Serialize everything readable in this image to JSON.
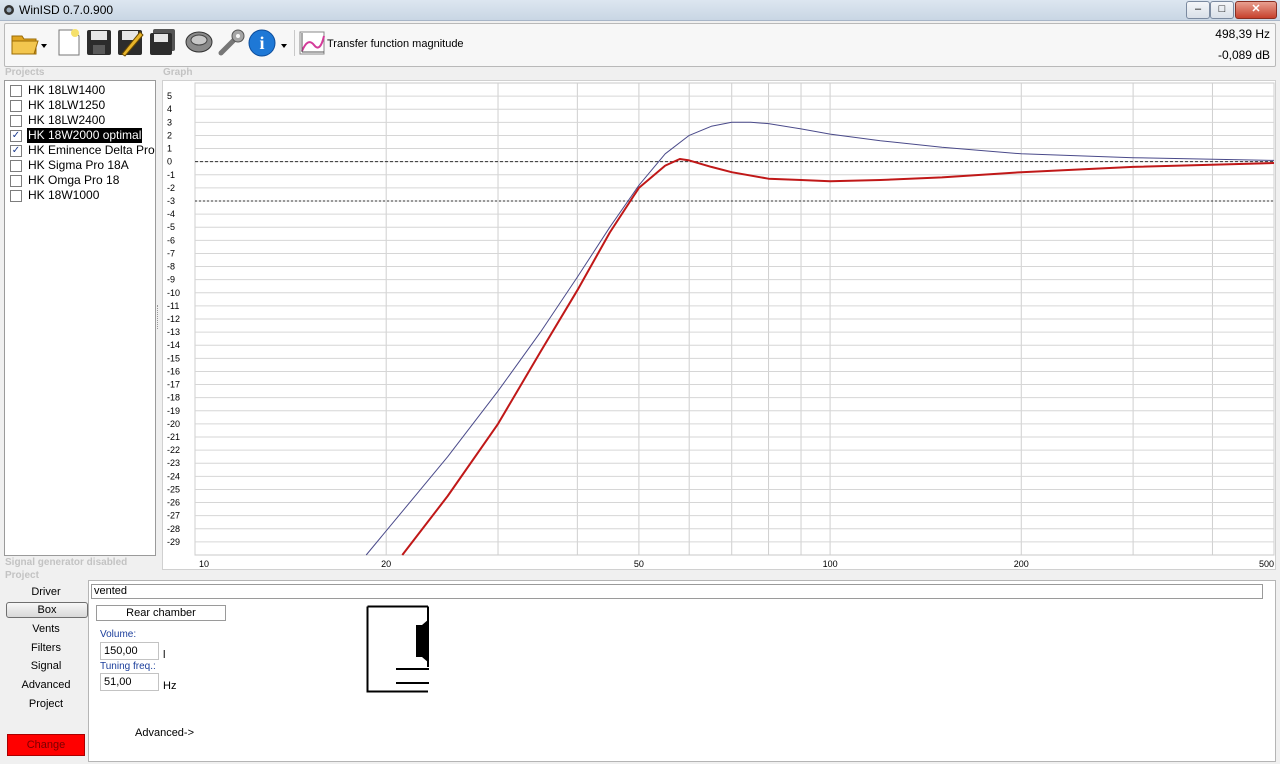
{
  "window": {
    "title": "WinISD 0.7.0.900",
    "min": "–",
    "max": "□",
    "close": "✕"
  },
  "toolbar": {
    "icons": [
      "open-folder-icon",
      "new-document-icon",
      "save-icon",
      "edit-icon",
      "save-all-icon",
      "driver-icon",
      "tools-icon",
      "info-icon",
      "graph-icon"
    ],
    "graph_label": "Transfer function magnitude",
    "readout_freq": "498,39 Hz",
    "readout_db": "-0,089 dB"
  },
  "projects": {
    "heading": "Projects",
    "items": [
      {
        "label": "HK 18LW1400",
        "checked": false,
        "selected": false
      },
      {
        "label": "HK 18LW1250",
        "checked": false,
        "selected": false
      },
      {
        "label": "HK 18LW2400",
        "checked": false,
        "selected": false
      },
      {
        "label": "HK 18W2000 optimal",
        "checked": true,
        "selected": true
      },
      {
        "label": "HK Eminence Delta Pro",
        "checked": true,
        "selected": false
      },
      {
        "label": "HK Sigma Pro 18A",
        "checked": false,
        "selected": false
      },
      {
        "label": "HK Omga Pro 18",
        "checked": false,
        "selected": false
      },
      {
        "label": "HK 18W1000",
        "checked": false,
        "selected": false
      }
    ]
  },
  "graph": {
    "heading": "Graph"
  },
  "signal_generator": "Signal generator disabled",
  "project_heading": "Project",
  "tabs": [
    "Driver",
    "Box",
    "Vents",
    "Filters",
    "Signal",
    "Advanced",
    "Project"
  ],
  "change_label": "Change",
  "box": {
    "type": "vented",
    "rear_chamber": "Rear chamber",
    "volume_label": "Volume:",
    "volume_value": "150,00",
    "volume_unit": "l",
    "tuning_label": "Tuning freq.:",
    "tuning_value": "51,00",
    "tuning_unit": "Hz",
    "advanced_link": "Advanced->"
  },
  "chart_data": {
    "type": "line",
    "x_scale": "log",
    "xlim": [
      10,
      500
    ],
    "ylim": [
      -30,
      6
    ],
    "x_ticks": [
      "10",
      "20",
      "50",
      "100",
      "200",
      "500"
    ],
    "y_ticks": [
      "5",
      "4",
      "3",
      "2",
      "1",
      "0",
      "-1",
      "-2",
      "-3",
      "-4",
      "-5",
      "-6",
      "-7",
      "-8",
      "-9",
      "-10",
      "-11",
      "-12",
      "-13",
      "-14",
      "-15",
      "-16",
      "-17",
      "-18",
      "-19",
      "-20",
      "-21",
      "-22",
      "-23",
      "-24",
      "-25",
      "-26",
      "-27",
      "-28",
      "-29"
    ],
    "reference_lines": [
      0,
      -3
    ],
    "series": [
      {
        "color": "#4a4a8a",
        "x": [
          18.6,
          25,
          30,
          35,
          40,
          45,
          50,
          55,
          60,
          65,
          70,
          75,
          80,
          90,
          100,
          120,
          150,
          200,
          300,
          500
        ],
        "y": [
          -30,
          -22.5,
          -17.5,
          -13,
          -8.8,
          -5,
          -1.8,
          0.6,
          2,
          2.7,
          3,
          3,
          2.9,
          2.5,
          2.1,
          1.6,
          1.1,
          0.6,
          0.3,
          0.1
        ]
      },
      {
        "color": "#c01818",
        "x": [
          21.2,
          25,
          30,
          35,
          40,
          45,
          50,
          55,
          58,
          60,
          65,
          70,
          80,
          90,
          100,
          120,
          150,
          200,
          300,
          500
        ],
        "y": [
          -30,
          -25.5,
          -20,
          -14.5,
          -9.8,
          -5.4,
          -2,
          -0.3,
          0.2,
          0.1,
          -0.4,
          -0.8,
          -1.3,
          -1.4,
          -1.5,
          -1.4,
          -1.2,
          -0.8,
          -0.4,
          -0.1
        ]
      }
    ]
  }
}
